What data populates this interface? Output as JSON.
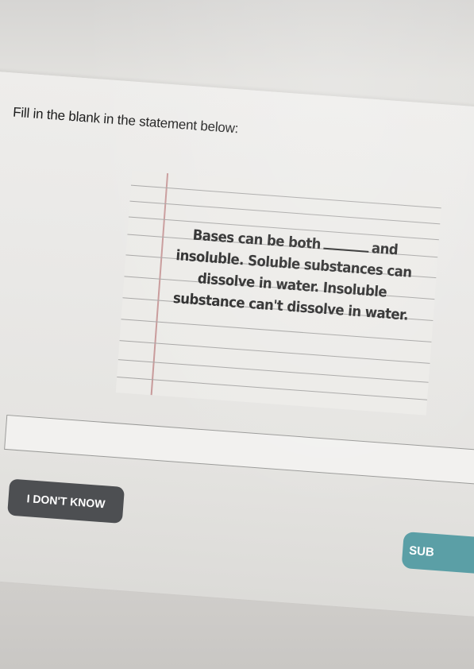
{
  "question": {
    "prompt": "Fill in the blank in the statement below:",
    "image_text": {
      "line1_before_blank": "Bases can be both",
      "line1_after_blank": "and",
      "line2": "insoluble. Soluble substances can",
      "line3": "dissolve in water. Insoluble",
      "line4": "substance can't dissolve in water."
    }
  },
  "answer": {
    "value": ""
  },
  "buttons": {
    "dont_know_label": "I DON'T KNOW",
    "submit_label": "SUB"
  }
}
